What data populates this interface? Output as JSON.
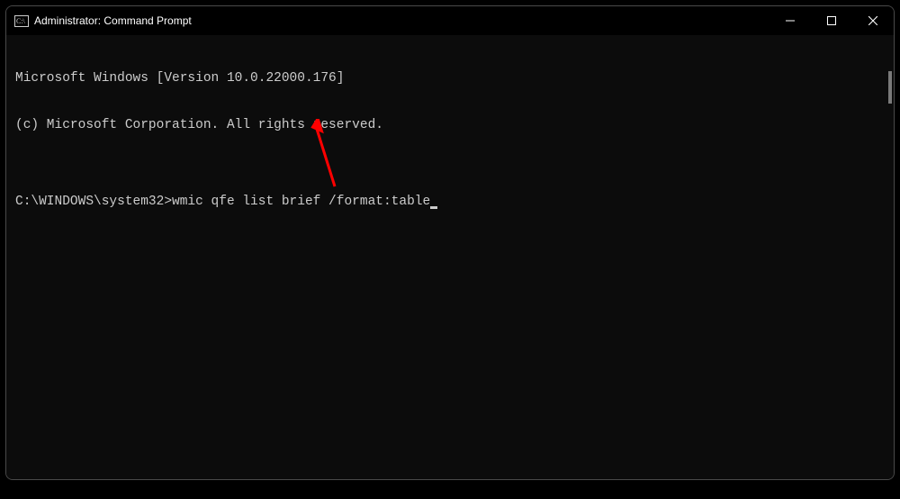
{
  "window": {
    "title": "Administrator: Command Prompt",
    "controls": {
      "minimize": "Minimize",
      "maximize": "Maximize",
      "close": "Close"
    }
  },
  "terminal": {
    "line1": "Microsoft Windows [Version 10.0.22000.176]",
    "line2": "(c) Microsoft Corporation. All rights reserved.",
    "blank": "",
    "prompt": "C:\\WINDOWS\\system32>",
    "command": "wmic qfe list brief /format:table"
  },
  "annotation": {
    "color": "#ff0000"
  }
}
